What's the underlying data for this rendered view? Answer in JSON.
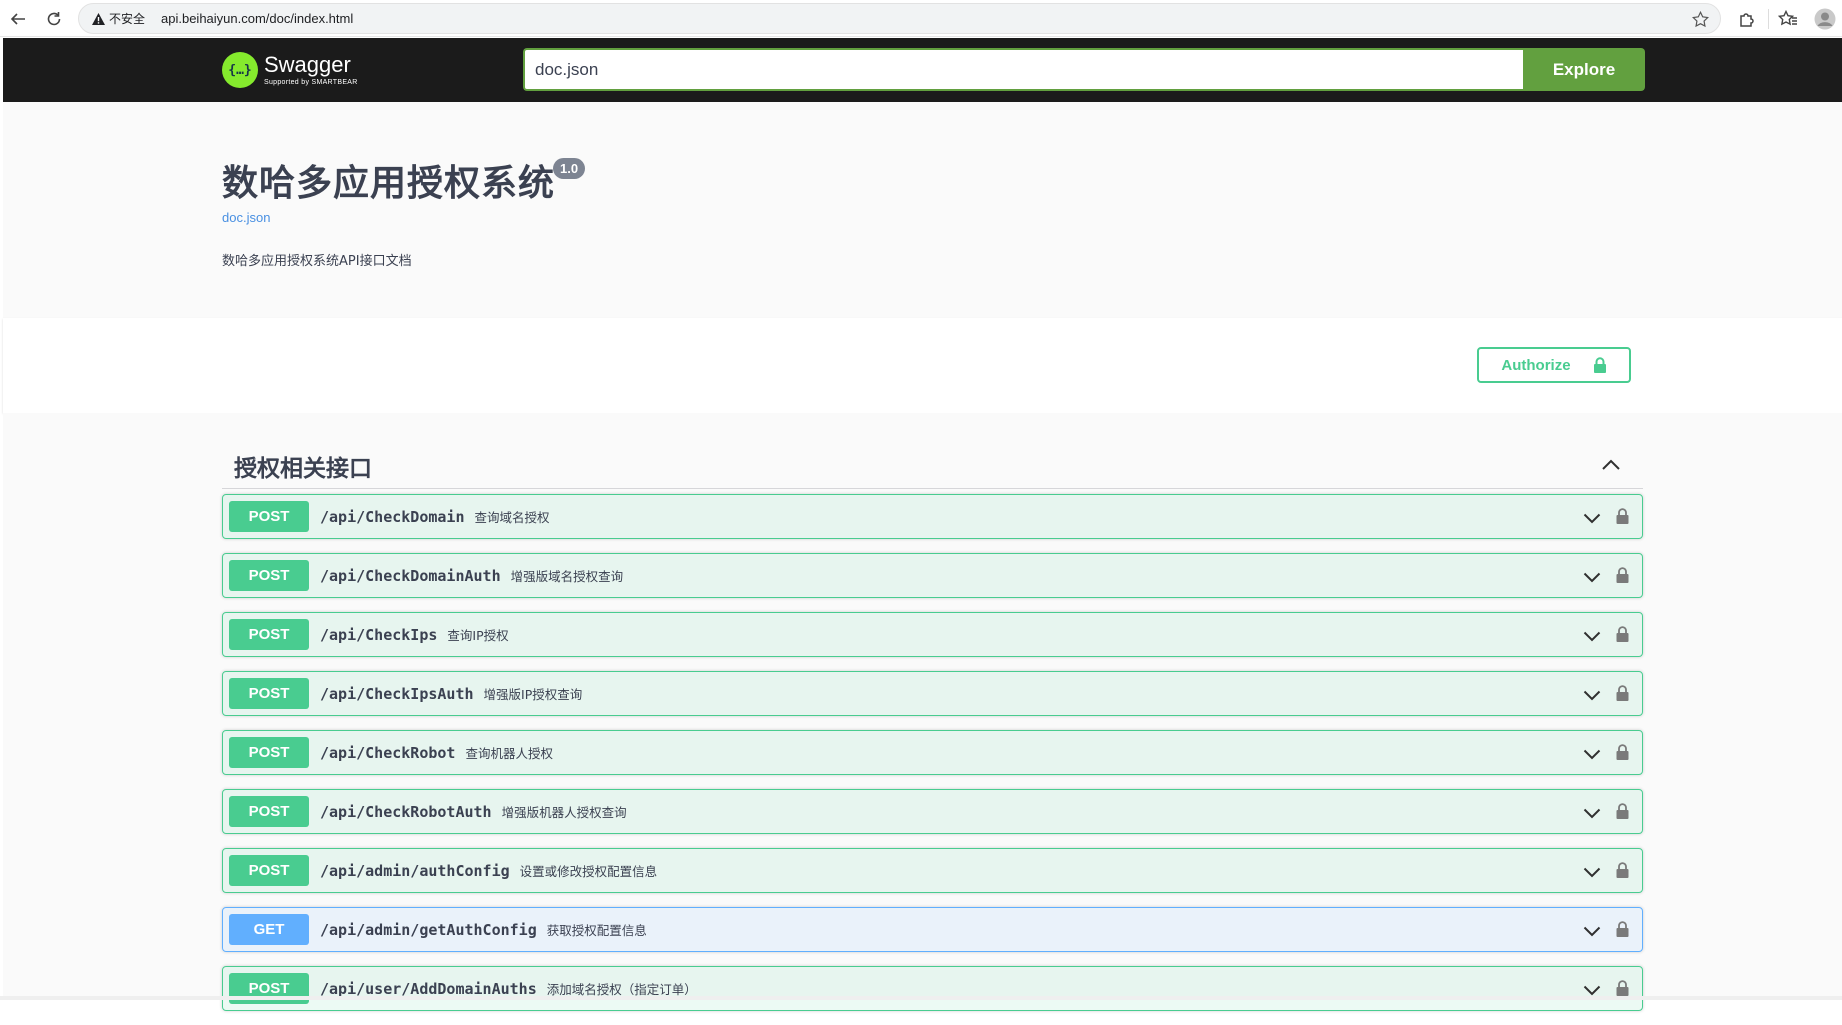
{
  "browser": {
    "insecure_label": "不安全",
    "url": "api.beihaiyun.com/doc/index.html"
  },
  "topbar": {
    "logo_title": "Swagger",
    "logo_subtitle": "Supported by SMARTBEAR",
    "logo_glyph": "{…}",
    "spec_input_value": "doc.json",
    "explore_label": "Explore"
  },
  "info": {
    "title": "数哈多应用授权系统",
    "version": "1.0",
    "spec_link": "doc.json",
    "description": "数哈多应用授权系统API接口文档"
  },
  "auth": {
    "authorize_label": "Authorize"
  },
  "tag": {
    "title": "授权相关接口"
  },
  "operations": [
    {
      "method": "POST",
      "path": "/api/CheckDomain",
      "summary": "查询域名授权"
    },
    {
      "method": "POST",
      "path": "/api/CheckDomainAuth",
      "summary": "增强版域名授权查询"
    },
    {
      "method": "POST",
      "path": "/api/CheckIps",
      "summary": "查询IP授权"
    },
    {
      "method": "POST",
      "path": "/api/CheckIpsAuth",
      "summary": "增强版IP授权查询"
    },
    {
      "method": "POST",
      "path": "/api/CheckRobot",
      "summary": "查询机器人授权"
    },
    {
      "method": "POST",
      "path": "/api/CheckRobotAuth",
      "summary": "增强版机器人授权查询"
    },
    {
      "method": "POST",
      "path": "/api/admin/authConfig",
      "summary": "设置或修改授权配置信息"
    },
    {
      "method": "GET",
      "path": "/api/admin/getAuthConfig",
      "summary": "获取授权配置信息"
    },
    {
      "method": "POST",
      "path": "/api/user/AddDomainAuths",
      "summary": "添加域名授权（指定订单）"
    }
  ],
  "colors": {
    "post": "#49cc90",
    "get": "#61affe",
    "topbar_bg": "#1b1b1b",
    "explore_green": "#62a03f"
  },
  "icons": {
    "back": "arrow-left-icon",
    "reload": "reload-icon",
    "warning": "warning-icon",
    "bookmark": "star-icon",
    "extensions": "puzzle-icon",
    "favorites": "favorites-icon",
    "profile": "profile-icon",
    "collapse": "chevron-up-icon",
    "expand": "chevron-down-icon",
    "lock": "lock-icon"
  }
}
